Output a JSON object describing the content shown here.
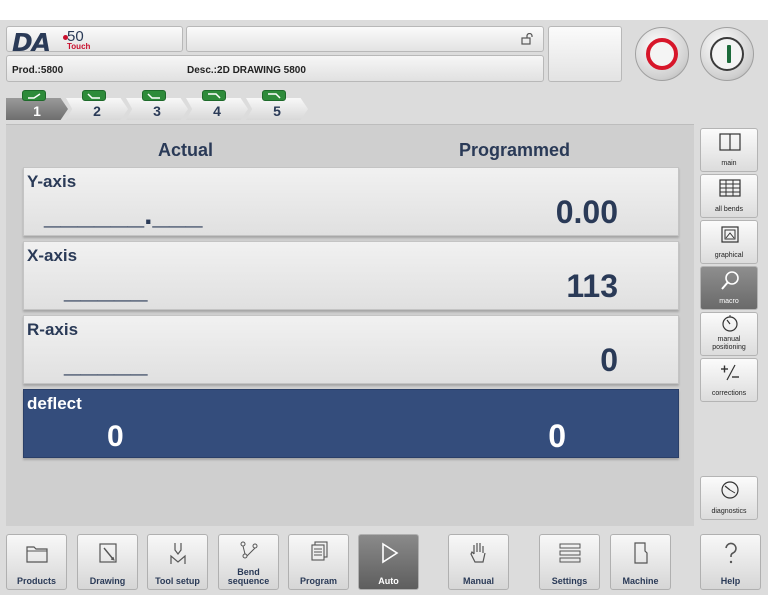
{
  "header": {
    "logo_brand": "DA",
    "logo_model": "50",
    "logo_sub": "Touch",
    "product": "Prod.:5800",
    "description": "Desc.:2D DRAWING 5800",
    "lock_icon": "unlock-icon",
    "stop_icon": "stop-icon",
    "start_icon": "start-icon"
  },
  "bend_tabs": [
    {
      "label": "1",
      "active": true
    },
    {
      "label": "2",
      "active": false
    },
    {
      "label": "3",
      "active": false
    },
    {
      "label": "4",
      "active": false
    },
    {
      "label": "5",
      "active": false
    }
  ],
  "columns": {
    "actual": "Actual",
    "programmed": "Programmed"
  },
  "axes": [
    {
      "name": "Y-axis",
      "actual": "______.___",
      "programmed": "0.00"
    },
    {
      "name": "X-axis",
      "actual": "_____",
      "programmed": "113"
    },
    {
      "name": "R-axis",
      "actual": "_____",
      "programmed": "0"
    },
    {
      "name": "deflect",
      "actual": "0",
      "programmed": "0",
      "selected": true
    }
  ],
  "sidebar": [
    {
      "label": "main",
      "icon": "main-view-icon"
    },
    {
      "label": "all bends",
      "icon": "all-bends-icon"
    },
    {
      "label": "graphical",
      "icon": "graphical-icon"
    },
    {
      "label": "macro",
      "icon": "magnifier-icon",
      "active": true
    },
    {
      "label": "manual positioning",
      "icon": "manual-positioning-icon"
    },
    {
      "label": "corrections",
      "icon": "corrections-icon"
    },
    {
      "label": "diagnostics",
      "icon": "diagnostics-icon"
    }
  ],
  "nav": [
    {
      "label": "Products",
      "icon": "folder-icon"
    },
    {
      "label": "Drawing",
      "icon": "drawing-icon"
    },
    {
      "label": "Tool setup",
      "icon": "tool-setup-icon"
    },
    {
      "label": "Bend sequence",
      "icon": "bend-sequence-icon"
    },
    {
      "label": "Program",
      "icon": "program-icon"
    },
    {
      "label": "Auto",
      "icon": "play-icon",
      "active": true
    },
    {
      "label": "Manual",
      "icon": "hand-icon"
    },
    {
      "label": "Settings",
      "icon": "settings-list-icon"
    },
    {
      "label": "Machine",
      "icon": "machine-icon"
    },
    {
      "label": "Help",
      "icon": "help-icon"
    }
  ],
  "colors": {
    "accent": "#344d7c",
    "stop": "#d7162a",
    "start": "#1c6a3a",
    "badge": "#2e8b3a"
  }
}
